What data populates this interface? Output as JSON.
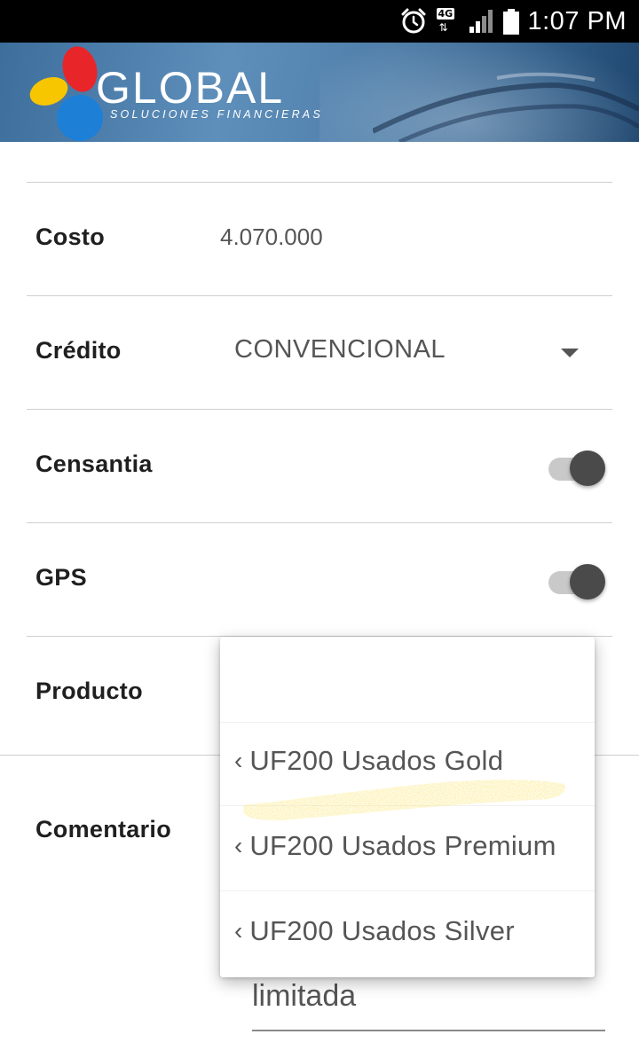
{
  "status_bar": {
    "time": "1:07 PM",
    "network_label": "4G",
    "network_arrows": "⇅",
    "icons": [
      "alarm-icon",
      "net-4g-icon",
      "signal-icon",
      "battery-icon"
    ]
  },
  "header": {
    "logo_word": "GLOBAL",
    "logo_tagline": "SOLUCIONES FINANCIERAS"
  },
  "form": {
    "costo": {
      "label": "Costo",
      "value": "4.070.000"
    },
    "credito": {
      "label": "Crédito",
      "selected": "CONVENCIONAL"
    },
    "censantia": {
      "label": "Censantia",
      "on": true
    },
    "gps": {
      "label": "GPS",
      "on": true
    },
    "producto": {
      "label": "Producto"
    },
    "comentario": {
      "label": "Comentario",
      "value": "limitada"
    }
  },
  "dropdown": {
    "options": [
      {
        "label": ""
      },
      {
        "label": "UF200 Usados Gold"
      },
      {
        "label": "UF200 Usados Premium"
      },
      {
        "label": "UF200 Usados Silver"
      }
    ]
  },
  "colors": {
    "toggle_thumb": "#4a4a4a",
    "toggle_track": "#c9c9c9",
    "highlight": "#f5c518",
    "logo_red": "#e8262a",
    "logo_yellow": "#f7c600",
    "logo_blue": "#1e7fd6"
  }
}
